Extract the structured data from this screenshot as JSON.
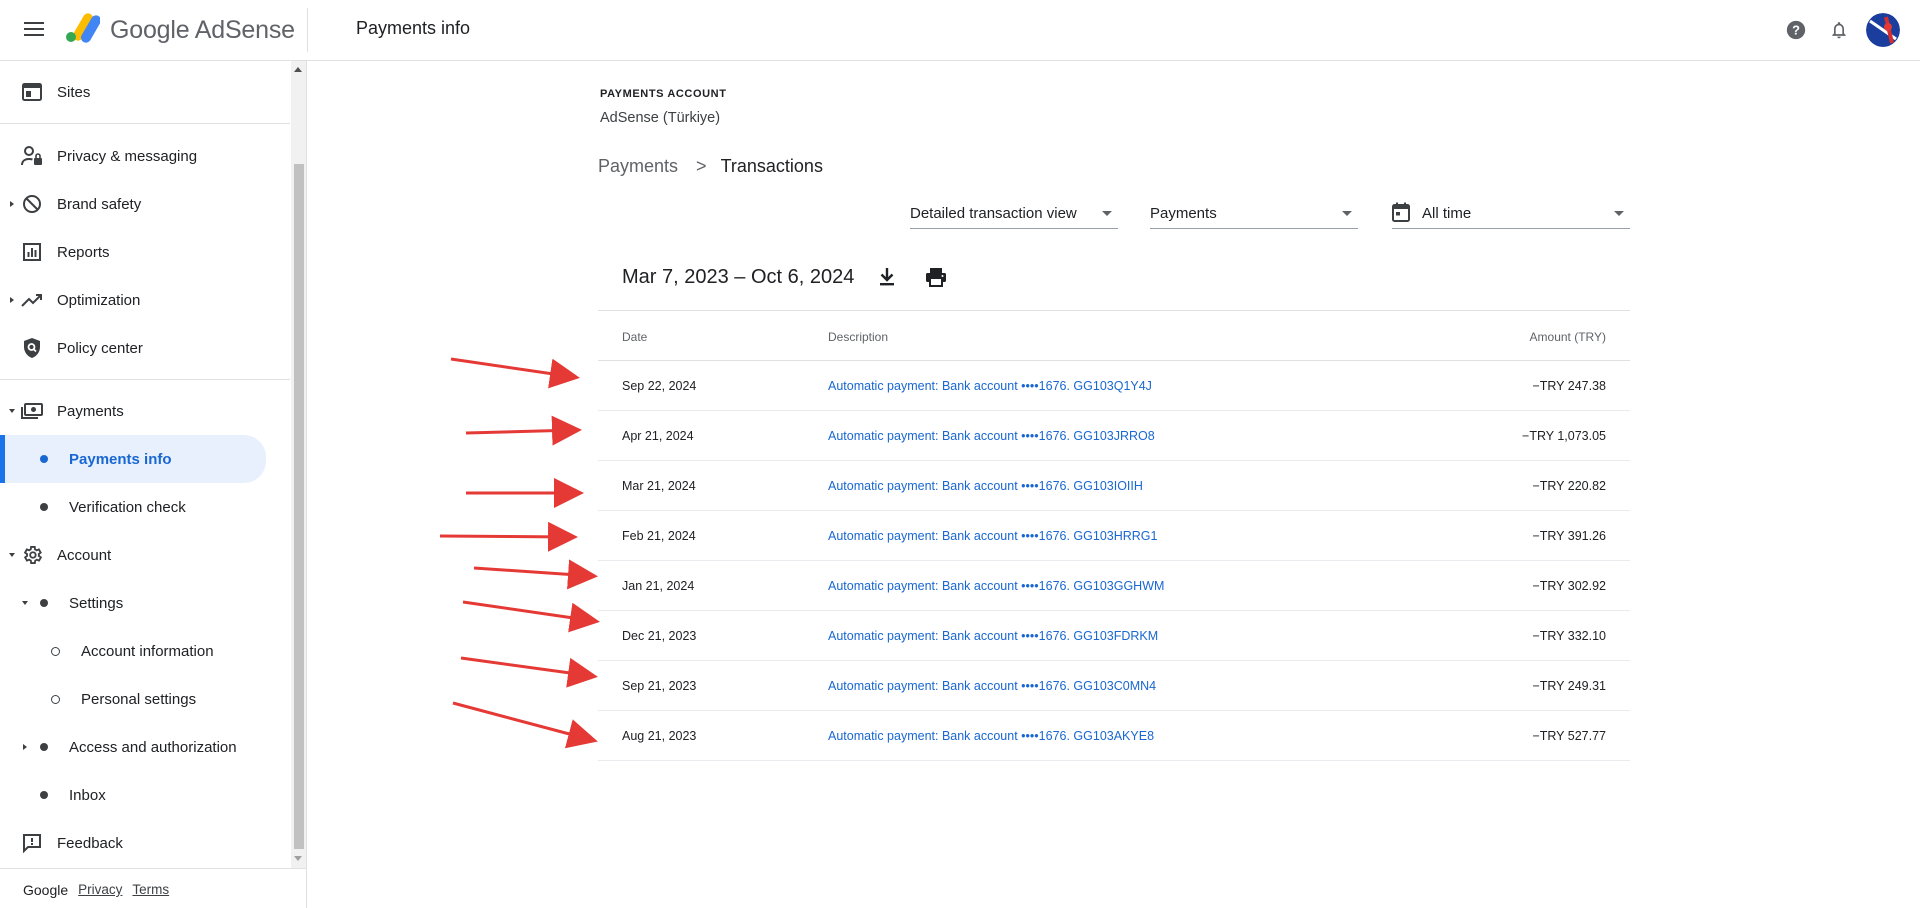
{
  "app": {
    "logo_text": "Google AdSense",
    "page_title": "Payments info"
  },
  "sidebar": {
    "items": [
      {
        "label": "Sites"
      },
      {
        "label": "Privacy & messaging"
      },
      {
        "label": "Brand safety"
      },
      {
        "label": "Reports"
      },
      {
        "label": "Optimization"
      },
      {
        "label": "Policy center"
      },
      {
        "label": "Payments"
      },
      {
        "label": "Payments info"
      },
      {
        "label": "Verification check"
      },
      {
        "label": "Account"
      },
      {
        "label": "Settings"
      },
      {
        "label": "Account information"
      },
      {
        "label": "Personal settings"
      },
      {
        "label": "Access and authorization"
      },
      {
        "label": "Inbox"
      },
      {
        "label": "Feedback"
      }
    ],
    "footer": {
      "brand": "Google",
      "privacy": "Privacy",
      "terms": "Terms"
    }
  },
  "main": {
    "account_kicker": "PAYMENTS ACCOUNT",
    "account_name": "AdSense (Türkiye)",
    "breadcrumb": {
      "parent": "Payments",
      "separator": ">",
      "current": "Transactions"
    },
    "filters": {
      "view": "Detailed transaction view",
      "type": "Payments",
      "period": "All time"
    },
    "date_range": "Mar 7, 2023 – Oct 6, 2024",
    "table": {
      "headers": {
        "date": "Date",
        "description": "Description",
        "amount": "Amount (TRY)"
      },
      "rows": [
        {
          "date": "Sep 22, 2024",
          "description": "Automatic payment: Bank account  ••••1676. GG103Q1Y4J",
          "amount": "−TRY 247.38"
        },
        {
          "date": "Apr 21, 2024",
          "description": "Automatic payment: Bank account  ••••1676. GG103JRRO8",
          "amount": "−TRY 1,073.05"
        },
        {
          "date": "Mar 21, 2024",
          "description": "Automatic payment: Bank account  ••••1676. GG103IOIIH",
          "amount": "−TRY 220.82"
        },
        {
          "date": "Feb 21, 2024",
          "description": "Automatic payment: Bank account  ••••1676. GG103HRRG1",
          "amount": "−TRY 391.26"
        },
        {
          "date": "Jan 21, 2024",
          "description": "Automatic payment: Bank account  ••••1676. GG103GGHWM",
          "amount": "−TRY 302.92"
        },
        {
          "date": "Dec 21, 2023",
          "description": "Automatic payment: Bank account  ••••1676. GG103FDRKM",
          "amount": "−TRY 332.10"
        },
        {
          "date": "Sep 21, 2023",
          "description": "Automatic payment: Bank account  ••••1676. GG103C0MN4",
          "amount": "−TRY 249.31"
        },
        {
          "date": "Aug 21, 2023",
          "description": "Automatic payment: Bank account  ••••1676. GG103AKYE8",
          "amount": "−TRY 527.77"
        }
      ]
    }
  },
  "colors": {
    "accent": "#1a73e8",
    "link": "#1967d2",
    "active_bg": "#e8f0fe",
    "annotation_arrow": "#e53935"
  },
  "icons": [
    "menu-icon",
    "adsense-logo-icon",
    "help-icon",
    "bell-icon",
    "avatar",
    "sites-icon",
    "privacy-icon",
    "brand-safety-icon",
    "reports-icon",
    "optimization-icon",
    "policy-icon",
    "payments-icon",
    "account-gear-icon",
    "feedback-icon",
    "calendar-icon",
    "download-icon",
    "print-icon"
  ]
}
